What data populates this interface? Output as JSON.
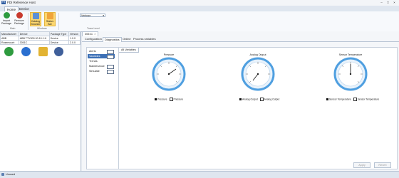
{
  "app": {
    "title": "FDI Reference Host"
  },
  "menu": {
    "tabs": [
      "Home",
      "Device"
    ]
  },
  "ribbon": {
    "buttons": [
      {
        "label": "Import Package",
        "icon": "import-package-icon"
      },
      {
        "label": "Remove Package",
        "icon": "remove-package-icon"
      },
      {
        "label": "Catalog Browser",
        "icon": "catalog-browser-icon"
      },
      {
        "label": "Status Bar",
        "icon": "status-bar-icon"
      }
    ],
    "groups": [
      "Main",
      "Windows",
      "Trace Level"
    ],
    "trace_level": "Verbose"
  },
  "device_table": {
    "headers": [
      "Manufacturer",
      "Device",
      "Package Type",
      "Version"
    ],
    "rows": [
      [
        "ABB",
        "ABB TTX300 00.10.1.H",
        "Device",
        "1.0.0"
      ],
      [
        "Rosemount",
        "3051C",
        "Device",
        "2.0.0"
      ]
    ]
  },
  "document": {
    "tab": "3051C",
    "close_glyph": "×",
    "subtabs": [
      "Configuration",
      "Diagnostics",
      "Online",
      "Process variables"
    ],
    "nav": [
      "Alerts",
      "Variables",
      "Trends",
      "Maintenance",
      "Simulate"
    ],
    "content_tab": "All Variables"
  },
  "gauges": [
    {
      "title": "Pressure",
      "legend": [
        "Pressure",
        "Pressure"
      ]
    },
    {
      "title": "Analog Output",
      "legend": [
        "Analog Output",
        "Analog Output"
      ]
    },
    {
      "title": "Sensor Temperature",
      "legend": [
        "Sensor Temperature",
        "Sensor Temperature"
      ]
    }
  ],
  "footer": {
    "apply": "Apply",
    "revert": "Revert"
  },
  "status": {
    "text": "Unused"
  }
}
